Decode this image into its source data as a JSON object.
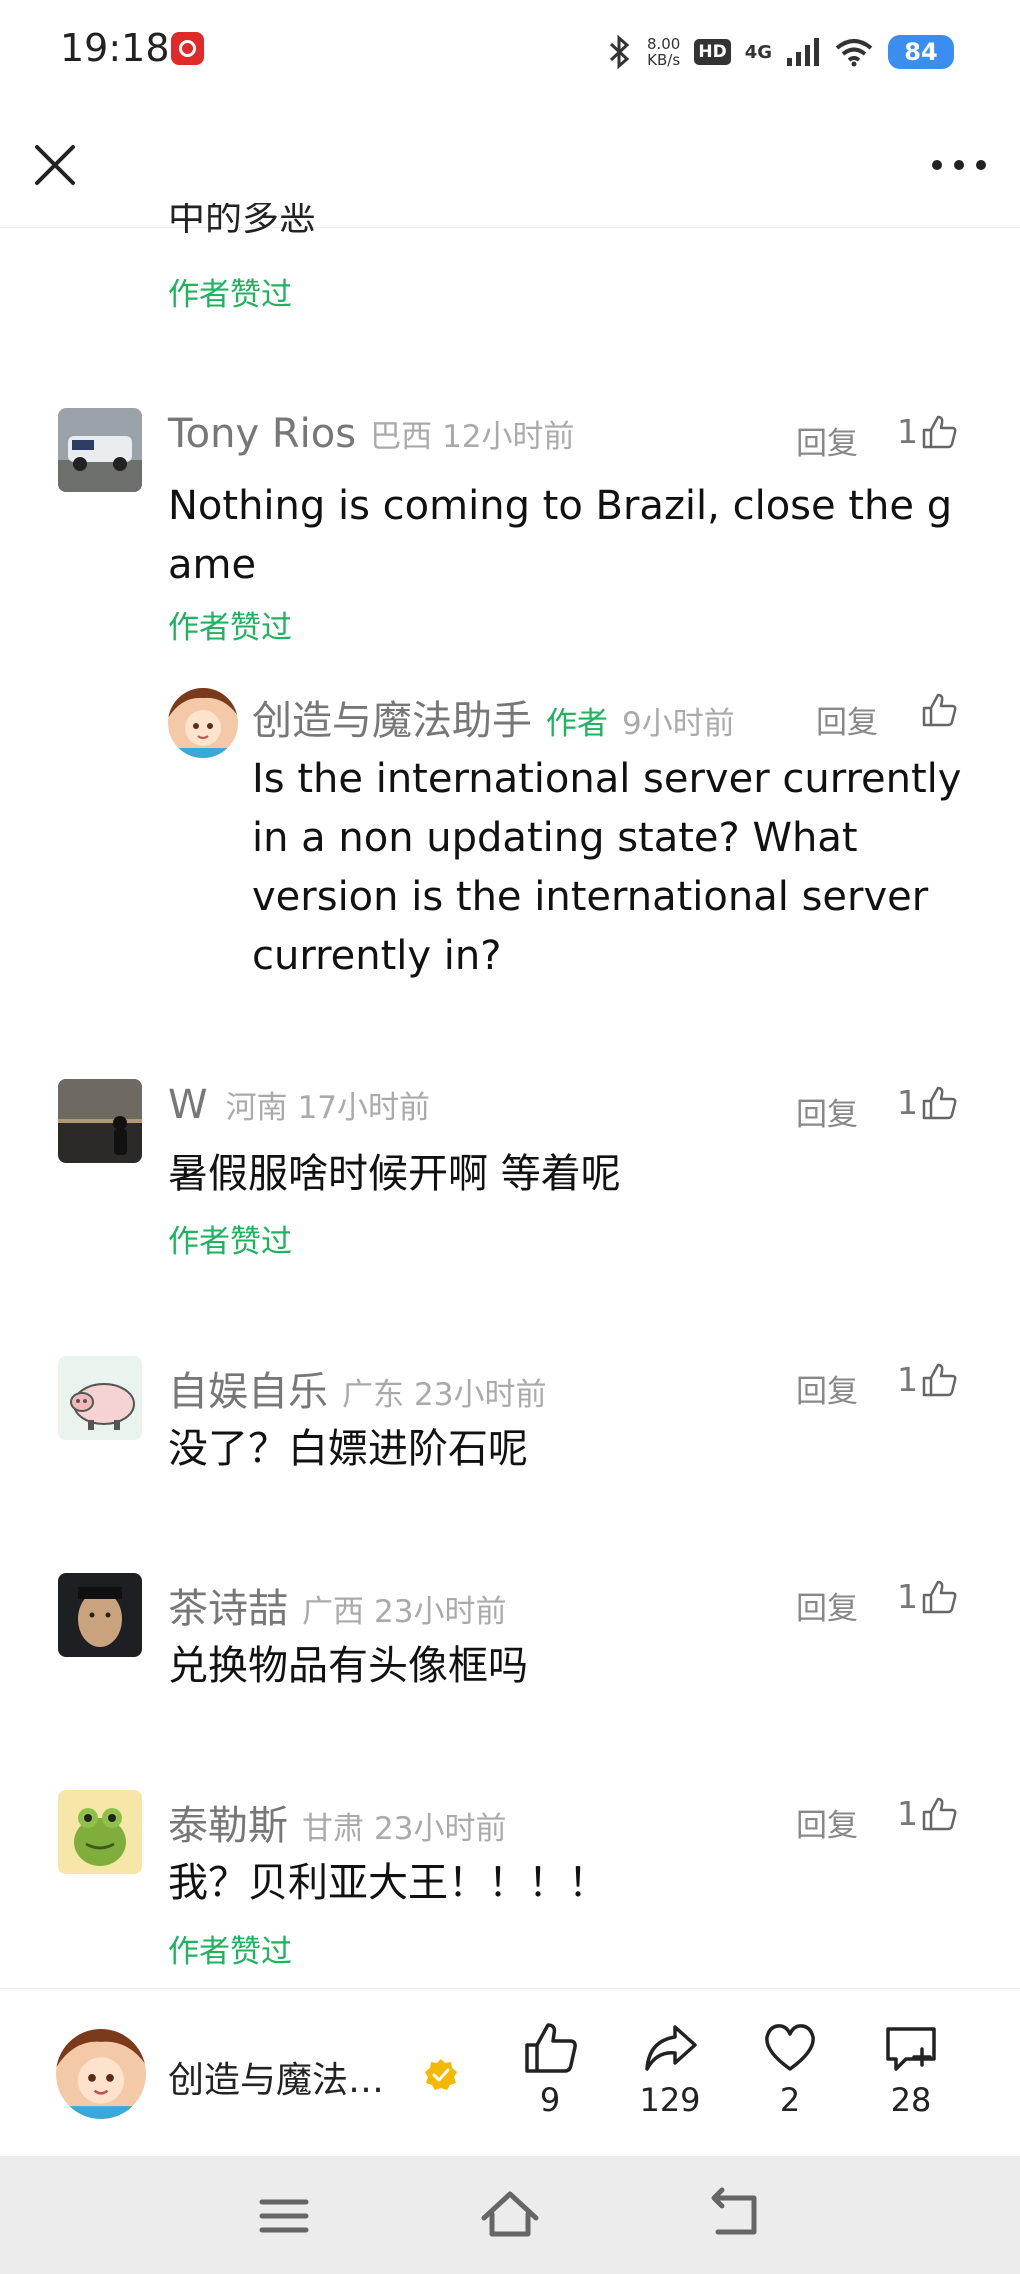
{
  "status": {
    "time": "19:18",
    "speed_value": "8.00",
    "speed_unit": "KB/s",
    "hd": "HD",
    "network": "4G",
    "battery": "84"
  },
  "top": {
    "partial_text": "中的多恶",
    "liked_label": "作者赞过"
  },
  "comments": [
    {
      "user": "Tony Rios",
      "location": "巴西",
      "time": "12小时前",
      "reply": "回复",
      "likes": "1",
      "text": "Nothing is coming to Brazil, close the game",
      "line1": "Nothing is coming to Brazil, close the g",
      "line2": "ame",
      "liked_label": "作者赞过"
    },
    {
      "user": "创造与魔法助手",
      "author_tag": "作者",
      "time": "9小时前",
      "reply": "回复",
      "line1": "Is the international server currently",
      "line2": "in a non updating state? What",
      "line3": "version is the international server",
      "line4": "currently in?"
    },
    {
      "user": "W",
      "location": "河南",
      "time": "17小时前",
      "reply": "回复",
      "likes": "1",
      "text": "暑假服啥时候开啊 等着呢",
      "liked_label": "作者赞过"
    },
    {
      "user": "自娱自乐",
      "location": "广东",
      "time": "23小时前",
      "reply": "回复",
      "likes": "1",
      "text": "没了？白嫖进阶石呢"
    },
    {
      "user": "茶诗喆",
      "location": "广西",
      "time": "23小时前",
      "reply": "回复",
      "likes": "1",
      "text": "兑换物品有头像框吗"
    },
    {
      "user": "泰勒斯",
      "location": "甘肃",
      "time": "23小时前",
      "reply": "回复",
      "likes": "1",
      "text": "我？贝利亚大王！！！！",
      "liked_label": "作者赞过"
    }
  ],
  "action_bar": {
    "author_name": "创造与魔法…",
    "like_count": "9",
    "share_count": "129",
    "favorite_count": "2",
    "comment_count": "28"
  },
  "colors": {
    "accent_green": "#1fb25f",
    "battery_blue": "#3a8ef0",
    "verified_gold": "#f5b800"
  }
}
